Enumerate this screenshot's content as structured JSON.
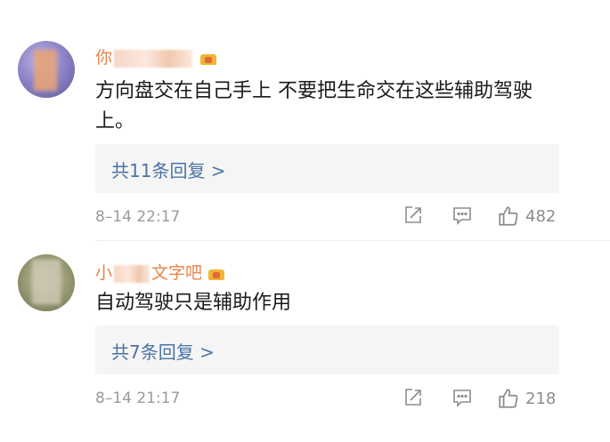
{
  "comments": [
    {
      "username_prefix": "你",
      "username_suffix": "",
      "content": "方向盘交在自己手上  不要把生命交在这些辅助驾驶上。",
      "replies": "共11条回复 >",
      "time": "8–14 22:17",
      "likes": "482"
    },
    {
      "username_prefix": "小",
      "username_suffix": "文字吧",
      "content": "自动驾驶只是辅助作用",
      "replies": "共7条回复 >",
      "time": "8–14 21:17",
      "likes": "218"
    }
  ],
  "colors": {
    "username": "#e8854b",
    "reply_link": "#4a73a5",
    "meta": "#9a9a9a"
  },
  "icons": [
    "share-icon",
    "comment-icon",
    "like-icon",
    "vip-crown-icon"
  ]
}
